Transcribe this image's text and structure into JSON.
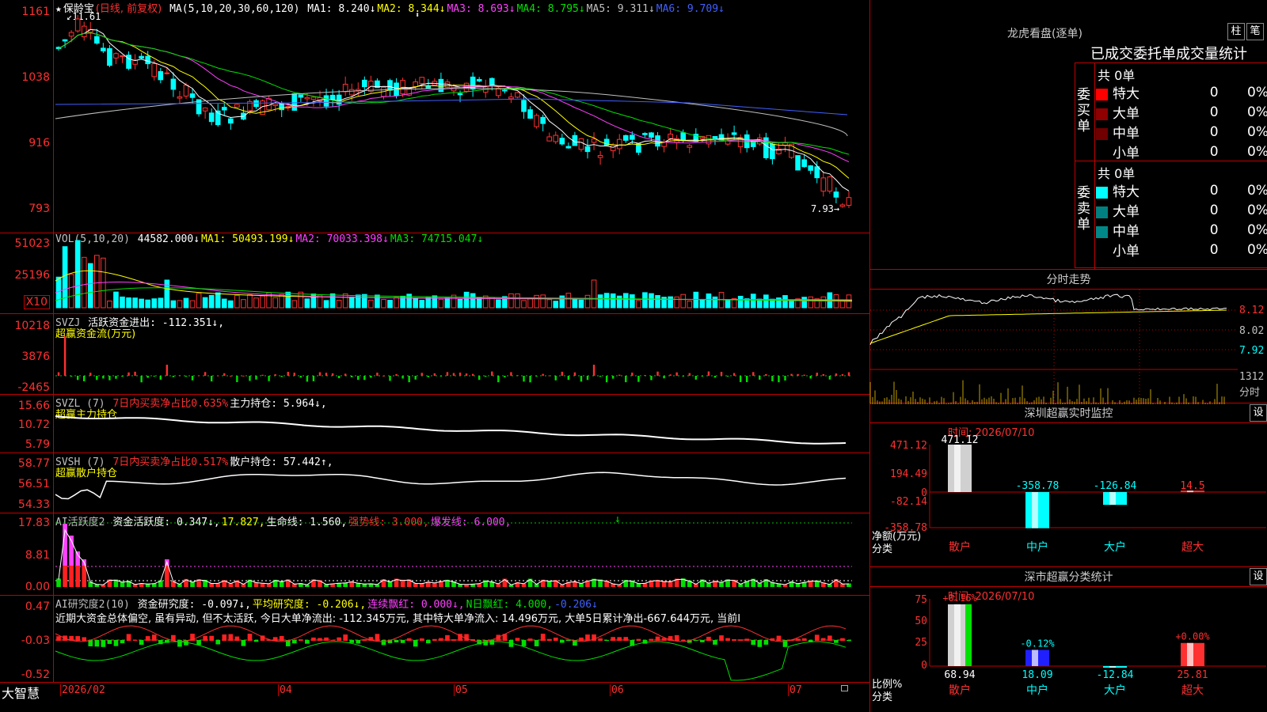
{
  "stock": {
    "name": "保龄宝",
    "mode": "(日线, 前复权)",
    "star": "★"
  },
  "main": {
    "ma_label": "MA(5,10,20,30,60,120)",
    "ma": [
      {
        "label": "MA1:",
        "value": "8.240↓",
        "color": "#ffffff"
      },
      {
        "label": "MA2:",
        "value": "8.344↓",
        "color": "#ffff00"
      },
      {
        "label": "MA3:",
        "value": "8.693↓",
        "color": "#ff40ff"
      },
      {
        "label": "MA4:",
        "value": "8.795↓",
        "color": "#00e000"
      },
      {
        "label": "MA5:",
        "value": "9.311↓",
        "color": "#c0c0c0"
      },
      {
        "label": "MA6:",
        "value": "9.709↓",
        "color": "#4060ff"
      }
    ],
    "yticks": [
      "1161",
      "1038",
      "916",
      "793"
    ],
    "high_label": "11.61",
    "low_label": "7.93"
  },
  "vol": {
    "label": "VOL(5,10,20)",
    "value": "44582.000↓",
    "ma1": "MA1: 50493.199↓",
    "ma2": "MA2: 70033.398↓",
    "ma3": "MA3: 74715.047↓",
    "yticks": [
      "51023",
      "25196"
    ],
    "unit": "X10"
  },
  "svzj": {
    "label": "SVZJ",
    "text": "活跃资金进出: -112.351↓,",
    "sub": "超赢资金流(万元)",
    "yticks": [
      "10218",
      "3876",
      "-2465"
    ]
  },
  "svzl": {
    "label": "SVZL (7)",
    "t1": "7日内买卖净占比0.635%",
    "t2": "主力持仓: 5.964↓,",
    "sub": "超赢主力持仓",
    "yticks": [
      "15.66",
      "10.72",
      "5.79"
    ]
  },
  "svsh": {
    "label": "SVSH (7)",
    "t1": "7日内买卖净占比0.517%",
    "t2": "散户持仓: 57.442↑,",
    "sub": "超赢散户持仓",
    "yticks": [
      "58.77",
      "56.51",
      "54.33"
    ]
  },
  "aihy": {
    "label": "AI活跃度2",
    "t1": "资金活跃度: 0.347↓,",
    "t2": "17.827,",
    "t3": "生命线: 1.560,",
    "t4": "强势线: 3.000,",
    "t5": "爆发线: 6.000,",
    "yticks": [
      "17.83",
      "8.81",
      "0.00"
    ]
  },
  "aiyj": {
    "label": "AI研究度2(10)",
    "t1": "资金研究度: -0.097↓,",
    "t2": "平均研究度: -0.206↓,",
    "t3": "连续飘红: 0.000↓,",
    "t4": "N日飘红: 4.000,",
    "t5": "-0.206↓",
    "comment": "近期大资金总体偏空, 虽有异动, 但不太活跃, 今日大单净流出: -112.345万元, 其中特大单净流入: 14.496万元, 大单5日累计净出-667.644万元, 当前I",
    "yticks": [
      "0.47",
      "-0.03",
      "-0.52"
    ]
  },
  "xaxis": {
    "brand": "大智慧",
    "labels": [
      "2026/02",
      "04",
      "05",
      "06",
      "07"
    ]
  },
  "longhu": {
    "title": "龙虎看盘(逐单)",
    "btn1": "柱",
    "btn2": "笔",
    "tabs": "已成交委托单成交量统计",
    "buy_label": "委买单",
    "sell_label": "委卖单",
    "buy_total": "共 0单",
    "sell_total": "共 0单",
    "buy_rows": [
      {
        "name": "特大",
        "count": "0",
        "pct": "0%",
        "color": "#ff0000"
      },
      {
        "name": "大单",
        "count": "0",
        "pct": "0%",
        "color": "#900000"
      },
      {
        "name": "中单",
        "count": "0",
        "pct": "0%",
        "color": "#700000"
      },
      {
        "name": "小单",
        "count": "0",
        "pct": "0%",
        "color": ""
      }
    ],
    "sell_rows": [
      {
        "name": "特大",
        "count": "0",
        "pct": "0%",
        "color": "#00ffff"
      },
      {
        "name": "大单",
        "count": "0",
        "pct": "0%",
        "color": "#008080"
      },
      {
        "name": "中单",
        "count": "0",
        "pct": "0%",
        "color": "#008888"
      },
      {
        "name": "小单",
        "count": "0",
        "pct": "0%",
        "color": ""
      }
    ]
  },
  "fenshi": {
    "title": "分时走势",
    "prices": [
      "8.12",
      "8.02",
      "7.92"
    ],
    "vol": "1312",
    "vol_unit": "分时"
  },
  "monitor": {
    "title": "深圳超赢实时监控",
    "btn": "设",
    "time": "时间: 2026/07/10",
    "yticks": [
      "471.12",
      "194.49",
      "0",
      "-82.14",
      "-358.78"
    ],
    "ylabel": "净额(万元)",
    "xlabel": "分类",
    "bars": [
      {
        "name": "散户",
        "value": 471.12,
        "label": "471.12"
      },
      {
        "name": "中户",
        "value": -358.78,
        "label": "-358.78"
      },
      {
        "name": "大户",
        "value": -126.84,
        "label": "-126.84"
      },
      {
        "name": "超大",
        "value": 14.5,
        "label": "14.5"
      }
    ]
  },
  "classify": {
    "title": "深市超赢分类统计",
    "btn": "设",
    "time": "时间: 2026/07/10",
    "yticks": [
      "75",
      "50",
      "25",
      "0"
    ],
    "ylabel": "比例%",
    "xlabel": "分类",
    "bars": [
      {
        "name": "散户",
        "value": 68.94,
        "label": "68.94",
        "delta": "+0.16%"
      },
      {
        "name": "中户",
        "value": 18.09,
        "label": "18.09",
        "delta": "-0.12%"
      },
      {
        "name": "大户",
        "value": -12.84,
        "label": "-12.84",
        "delta": ""
      },
      {
        "name": "超大",
        "value": 25.81,
        "label": "25.81",
        "delta": "+0.00%"
      }
    ]
  }
}
